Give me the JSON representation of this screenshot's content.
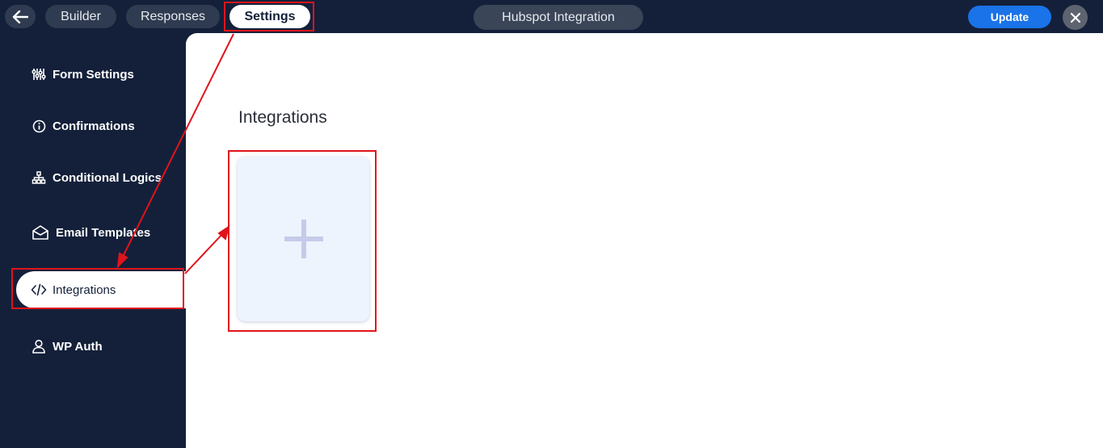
{
  "topbar": {
    "tabs": [
      {
        "label": "Builder"
      },
      {
        "label": "Responses"
      },
      {
        "label": "Settings",
        "active": true
      }
    ],
    "form_title": "Hubspot Integration",
    "update_label": "Update",
    "icons": {
      "back": "arrow-left-icon",
      "close": "close-icon"
    }
  },
  "sidebar": {
    "items": [
      {
        "label": "Form Settings",
        "icon": "sliders-icon"
      },
      {
        "label": "Confirmations",
        "icon": "info-circle-icon"
      },
      {
        "label": "Conditional Logics",
        "icon": "sitemap-icon"
      },
      {
        "label": "Email Templates",
        "icon": "envelope-open-icon"
      },
      {
        "label": "Integrations",
        "icon": "code-icon",
        "active": true
      },
      {
        "label": "WP Auth",
        "icon": "user-icon"
      }
    ]
  },
  "main": {
    "title": "Integrations",
    "add_card_icon": "plus-icon"
  },
  "colors": {
    "navy": "#14203a",
    "accent_blue": "#1a73e8",
    "highlight_red": "#e0141b",
    "card_bg": "#eef4fd",
    "plus": "#c5cbe8"
  }
}
